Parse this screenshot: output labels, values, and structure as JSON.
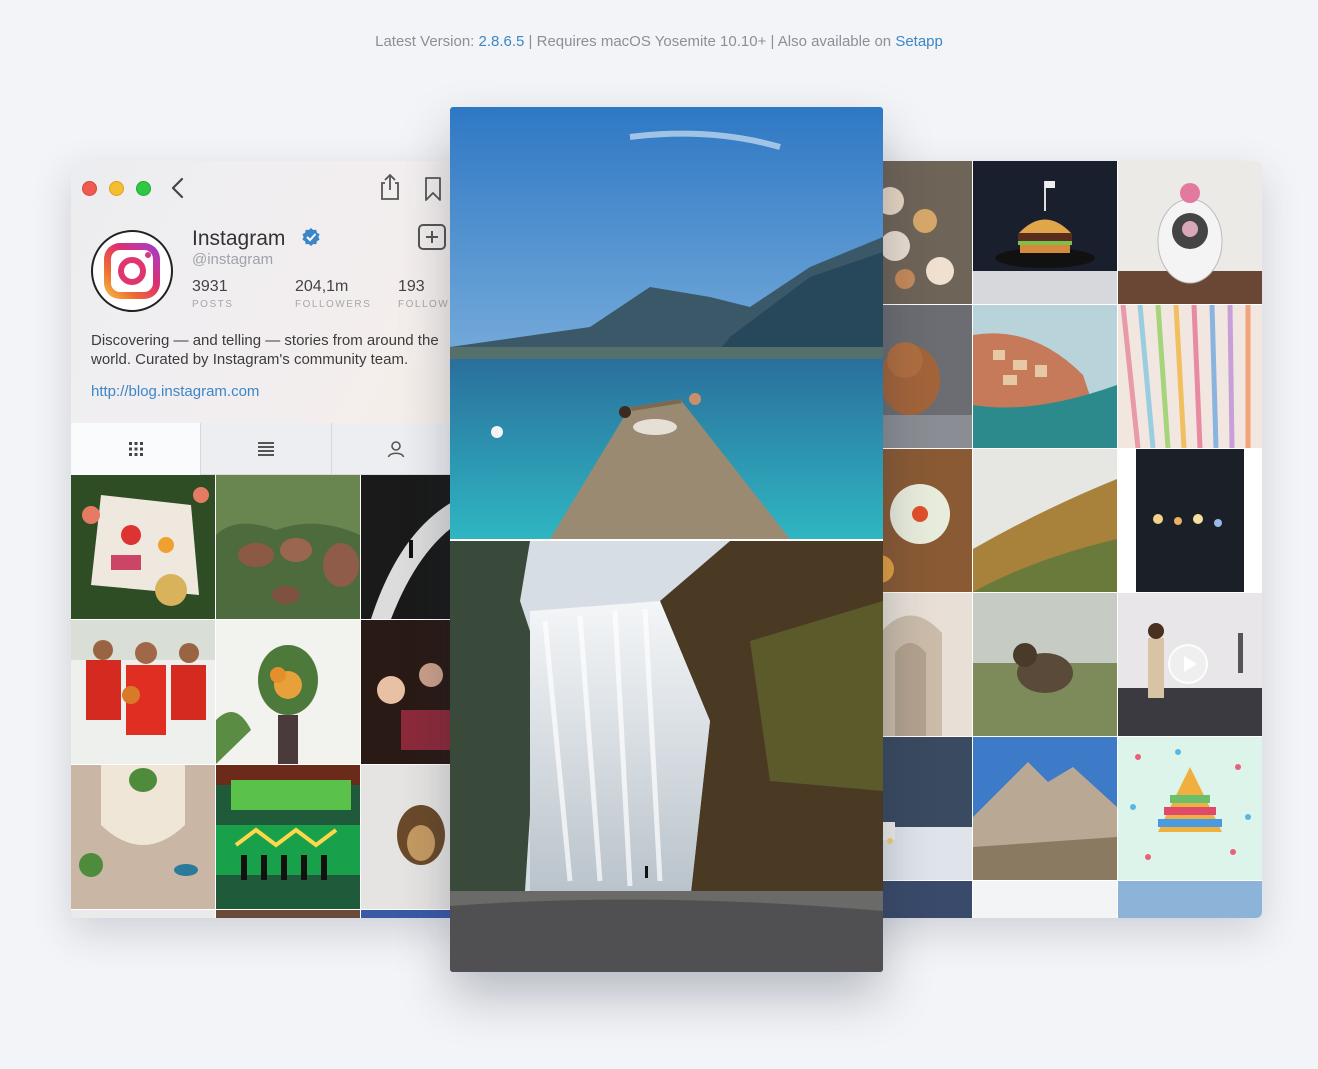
{
  "version_line": {
    "prefix": "Latest Version: ",
    "version": "2.8.6.5",
    "sep1": " | Requires macOS Yosemite 10.10+ | Also available on ",
    "setapp": "Setapp"
  },
  "colors": {
    "background": "#f3f4f7",
    "link": "#3d86c6",
    "verified": "#3d86c6"
  },
  "left_window": {
    "icons": [
      "back-chevron-icon",
      "share-icon",
      "bookmark-icon",
      "add-post-icon",
      "verified-badge-icon"
    ],
    "profile": {
      "name": "Instagram",
      "handle": "@instagram",
      "stats": [
        {
          "value": "3931",
          "label": "POSTS"
        },
        {
          "value": "204,1m",
          "label": "FOLLOWERS"
        },
        {
          "value": "193",
          "label": "FOLLOW"
        }
      ],
      "bio": "Discovering — and telling — stories from around the world. Curated by Instagram's community team.",
      "link": "http://blog.instagram.com"
    },
    "tabs": [
      "grid-view-icon",
      "list-view-icon",
      "tagged-user-icon"
    ],
    "photos": [
      "picnic",
      "elephants",
      "black-white-person",
      "basketball-team",
      "flower-bouquet",
      "party-crowd",
      "pool-aerial",
      "stadium-ceremony",
      "lion"
    ]
  },
  "center_panel": {
    "photos": [
      "lake-pier",
      "waterfall"
    ]
  },
  "right_window": {
    "photos": [
      "breakfast-table",
      "burger",
      "cat-figure",
      "poodle",
      "cliff-village",
      "color-pencils",
      "dumplings",
      "mountain-hillside",
      "bokeh-lights",
      "arched-corridor",
      "ram-in-fog",
      "woman-rooftop-video",
      "car-snow-forest",
      "rock-formations",
      "confetti-tree",
      "blue-strip",
      "white-strip",
      "palm-sky"
    ],
    "video_play_icon": "play-icon"
  }
}
